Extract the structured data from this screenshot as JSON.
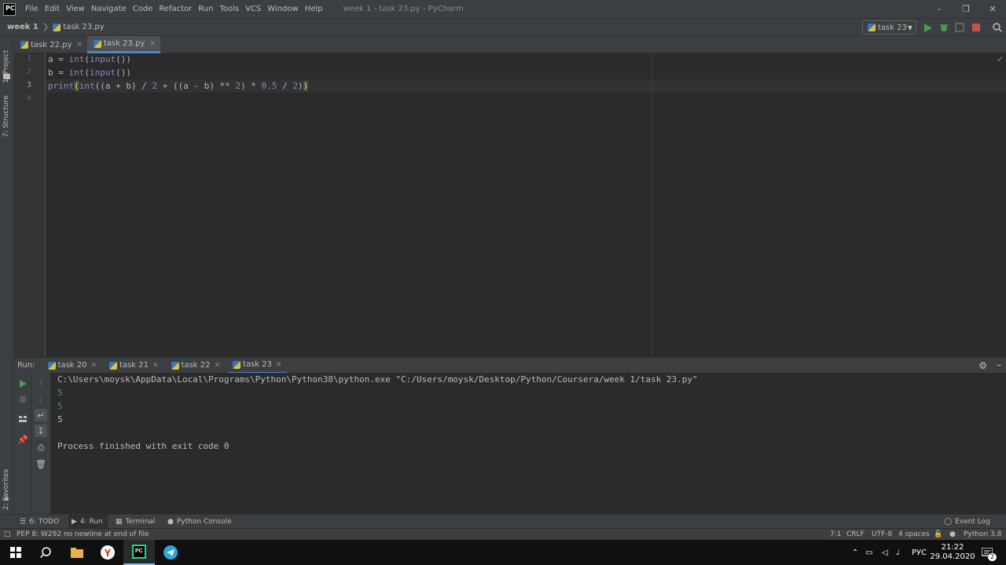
{
  "app": {
    "logo_text": "PC",
    "window_title": "week 1 - task 23.py - PyCharm"
  },
  "menu": {
    "file": "File",
    "edit": "Edit",
    "view": "View",
    "navigate": "Navigate",
    "code": "Code",
    "refactor": "Refactor",
    "run": "Run",
    "tools": "Tools",
    "vcs": "VCS",
    "window": "Window",
    "help": "Help"
  },
  "navbar": {
    "project": "week 1",
    "file": "task 23.py",
    "run_config": "task 23"
  },
  "left_stripe": {
    "project": "1: Project",
    "structure": "7: Structure",
    "favorites": "2: Favorites"
  },
  "editor_tabs": [
    {
      "label": "task 22.py"
    },
    {
      "label": "task 23.py"
    }
  ],
  "editor": {
    "line_numbers": [
      "1",
      "2",
      "3",
      "4"
    ],
    "line1": {
      "var": "a = ",
      "fn": "int",
      "open": "(",
      "fn2": "input",
      "rest": "())"
    },
    "line2": {
      "var": "b = ",
      "fn": "int",
      "open": "(",
      "fn2": "input",
      "rest": "())"
    },
    "line3": {
      "print": "print",
      "open_brace": "(",
      "int": "int",
      "p1": "((a + b) / ",
      "n1": "2",
      "p2": " + ((a - b) ** ",
      "n2": "2",
      "p3": ") * ",
      "n3": "0.5",
      "p4": " / ",
      "n4": "2",
      "p5": ")",
      "close_brace": ")"
    }
  },
  "run_window": {
    "label": "Run:",
    "tabs": [
      {
        "label": "task 20"
      },
      {
        "label": "task 21"
      },
      {
        "label": "task 22"
      },
      {
        "label": "task 23"
      }
    ],
    "console": {
      "command": "C:\\Users\\moysk\\AppData\\Local\\Programs\\Python\\Python38\\python.exe \"C:/Users/moysk/Desktop/Python/Coursera/week 1/task 23.py\"",
      "input1": "5",
      "input2": "5",
      "output": "5",
      "finished": "Process finished with exit code 0"
    }
  },
  "bottom_tabs": {
    "todo": "6: TODO",
    "run": "4: Run",
    "terminal": "Terminal",
    "python_console": "Python Console",
    "event_log": "Event Log"
  },
  "status_bar": {
    "message": "PEP 8: W292 no newline at end of file",
    "position": "7:1",
    "line_sep": "CRLF",
    "encoding": "UTF-8",
    "indent": "4 spaces",
    "interpreter": "Python 3.8"
  },
  "taskbar": {
    "language": "РУС",
    "time": "21:22",
    "date": "29.04.2020",
    "notification_count": "2"
  },
  "colors": {
    "accent": "#4a88c7",
    "run_green": "#499c54",
    "stop_red": "#c75450"
  }
}
